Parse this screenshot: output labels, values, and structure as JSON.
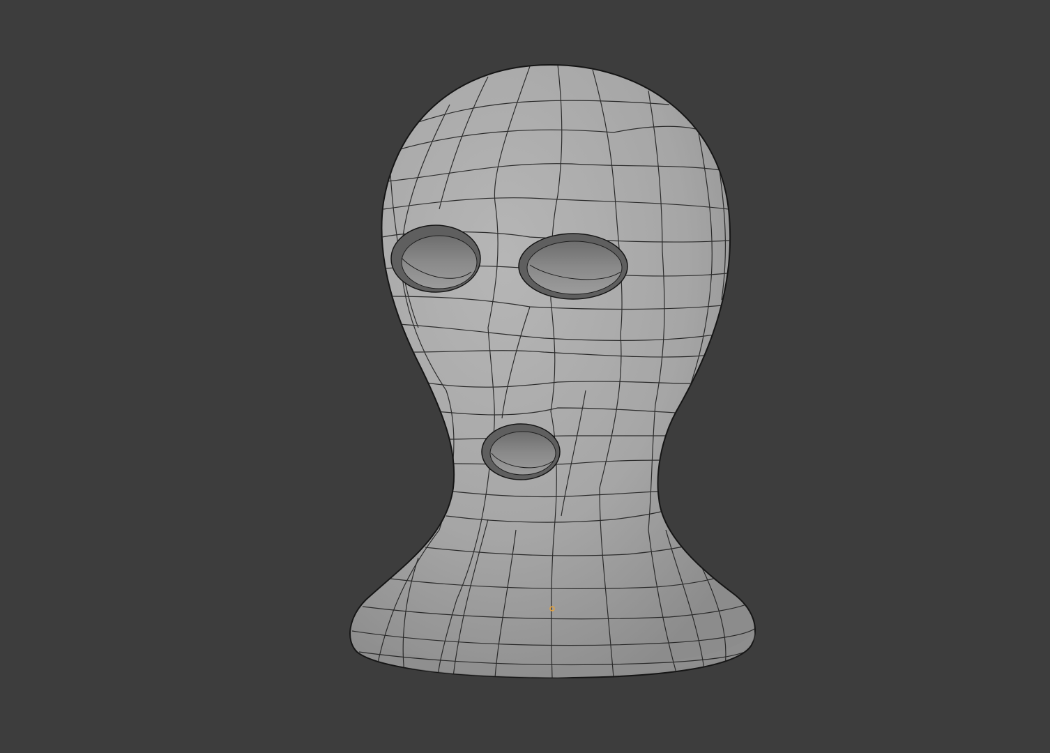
{
  "viewport": {
    "background_color": "#3d3d3d",
    "object": {
      "name": "balaclava-mesh",
      "shading": "solid",
      "wireframe_overlay": true,
      "surface_color": "#a9a9a9",
      "wire_color": "#1a1a1a",
      "openings": [
        "left-eye-hole",
        "right-eye-hole",
        "mouth-hole"
      ]
    },
    "origin_marker_color": "#e8a33a"
  }
}
